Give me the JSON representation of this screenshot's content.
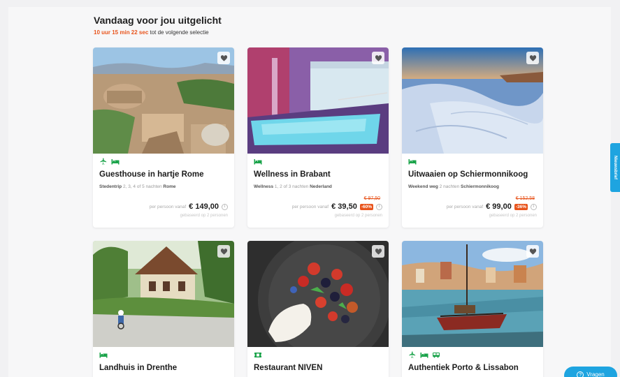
{
  "section": {
    "title": "Vandaag voor jou uitgelicht",
    "countdown_time": "10 uur 15 min 22 sec",
    "countdown_suffix": " tot de volgende selectie"
  },
  "colors": {
    "accent_orange": "#e8541c",
    "accent_green": "#1aa34a",
    "accent_blue": "#1ea4e0"
  },
  "cards": [
    {
      "icons": [
        "plane-icon",
        "bed-icon"
      ],
      "title": "Guesthouse in hartje Rome",
      "category": "Stedentrip",
      "nights": " 2, 3, 4 of 5 nachten ",
      "location": "Rome",
      "old_price": "",
      "from_label": "per persoon vanaf",
      "price": "€ 149,00",
      "discount": "",
      "basis": "gebaseerd op 2 personen"
    },
    {
      "icons": [
        "bed-icon"
      ],
      "title": "Wellness in Brabant",
      "category": "Wellness",
      "nights": " 1, 2 of 3 nachten ",
      "location": "Nederland",
      "old_price": "€ 97,50",
      "from_label": "per persoon vanaf",
      "price": "€ 39,50",
      "discount": "-60%",
      "basis": "gebaseerd op 2 personen"
    },
    {
      "icons": [
        "bed-icon"
      ],
      "title": "Uitwaaien op Schiermonnikoog",
      "category": "Weekend weg",
      "nights": " 2 nachten ",
      "location": "Schiermonnikoog",
      "old_price": "€ 152,58",
      "from_label": "per persoon vanaf",
      "price": "€ 99,00",
      "discount": "-36%",
      "basis": "gebaseerd op 2 personen"
    },
    {
      "icons": [
        "bed-icon"
      ],
      "title": "Landhuis in Drenthe"
    },
    {
      "icons": [
        "ticket-icon"
      ],
      "title": "Restaurant NIVEN"
    },
    {
      "icons": [
        "plane-icon",
        "bed-icon",
        "bus-icon"
      ],
      "title": "Authentiek Porto & Lissabon"
    }
  ],
  "side_tab": "Nieuwsbrief",
  "help_button": "Vragen"
}
